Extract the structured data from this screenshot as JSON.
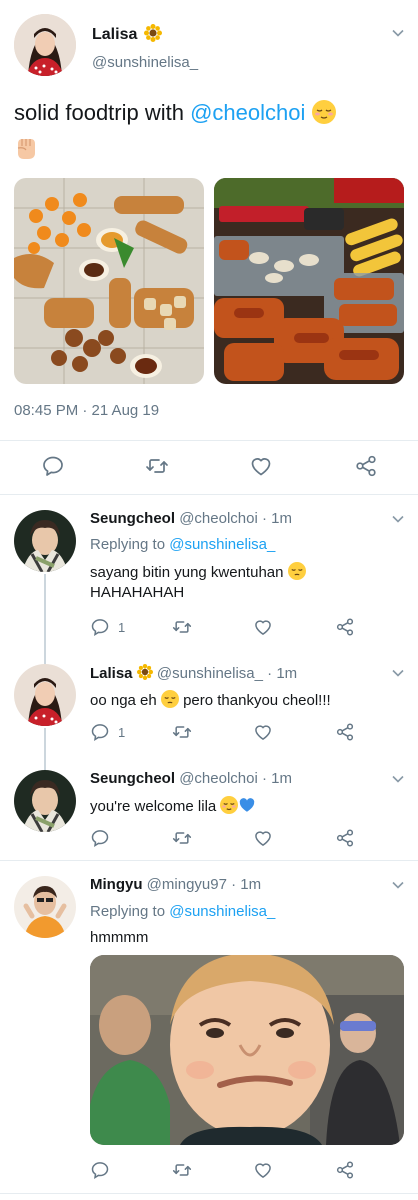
{
  "main_tweet": {
    "name": "Lalisa",
    "handle": "@sunshinelisa_",
    "text_before": "solid foodtrip with ",
    "mention": "@cheolchoi",
    "timestamp": "08:45 PM · 21 Aug 19",
    "images": [
      "street-food-spread",
      "grilled-skewers"
    ]
  },
  "replies": [
    {
      "name": "Seungcheol",
      "handle_time": "@cheolchoi · 1m",
      "replying_prefix": "Replying to ",
      "replying_handle": "@sunshinelisa_",
      "line1": "sayang bitin yung kwentuhan",
      "line2": "HAHAHAHAH",
      "reply_count": "1"
    },
    {
      "name": "Lalisa",
      "handle_time": "@sunshinelisa_ · 1m",
      "line1_a": "oo nga eh",
      "line1_b": "pero thankyou cheol!!!",
      "reply_count": "1"
    },
    {
      "name": "Seungcheol",
      "handle_time": "@cheolchoi · 1m",
      "line1": "you're welcome lila"
    },
    {
      "name": "Mingyu",
      "handle_time": "@mingyu97 · 1m",
      "replying_prefix": "Replying to ",
      "replying_handle": "@sunshinelisa_",
      "line1": "hmmmm",
      "image": "smirking-child-photo"
    }
  ],
  "colors": {
    "accent": "#1da1f2",
    "secondary_text": "#657786",
    "divider": "#e6ecf0",
    "icon": "#657786"
  }
}
